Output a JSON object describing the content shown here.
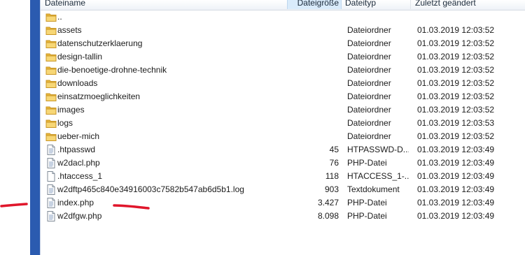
{
  "columns": {
    "name": "Dateiname",
    "size": "Dateigröße",
    "type": "Dateityp",
    "modified": "Zuletzt geändert"
  },
  "files": [
    {
      "name": "..",
      "size": "",
      "type": "",
      "modified": "",
      "icon": "folder-icon"
    },
    {
      "name": "assets",
      "size": "",
      "type": "Dateiordner",
      "modified": "01.03.2019 12:03:52",
      "icon": "folder-icon"
    },
    {
      "name": "datenschutzerklaerung",
      "size": "",
      "type": "Dateiordner",
      "modified": "01.03.2019 12:03:52",
      "icon": "folder-icon"
    },
    {
      "name": "design-tallin",
      "size": "",
      "type": "Dateiordner",
      "modified": "01.03.2019 12:03:52",
      "icon": "folder-icon"
    },
    {
      "name": "die-benoetige-drohne-technik",
      "size": "",
      "type": "Dateiordner",
      "modified": "01.03.2019 12:03:52",
      "icon": "folder-icon"
    },
    {
      "name": "downloads",
      "size": "",
      "type": "Dateiordner",
      "modified": "01.03.2019 12:03:52",
      "icon": "folder-icon"
    },
    {
      "name": "einsatzmoeglichkeiten",
      "size": "",
      "type": "Dateiordner",
      "modified": "01.03.2019 12:03:52",
      "icon": "folder-icon"
    },
    {
      "name": "images",
      "size": "",
      "type": "Dateiordner",
      "modified": "01.03.2019 12:03:52",
      "icon": "folder-icon"
    },
    {
      "name": "logs",
      "size": "",
      "type": "Dateiordner",
      "modified": "01.03.2019 12:03:53",
      "icon": "folder-icon"
    },
    {
      "name": "ueber-mich",
      "size": "",
      "type": "Dateiordner",
      "modified": "01.03.2019 12:03:52",
      "icon": "folder-icon"
    },
    {
      "name": ".htpasswd",
      "size": "45",
      "type": "HTPASSWD-D...",
      "modified": "01.03.2019 12:03:49",
      "icon": "text-file-icon"
    },
    {
      "name": "w2dacl.php",
      "size": "76",
      "type": "PHP-Datei",
      "modified": "01.03.2019 12:03:49",
      "icon": "text-file-icon"
    },
    {
      "name": ".htaccess_1",
      "size": "118",
      "type": "HTACCESS_1-...",
      "modified": "01.03.2019 12:03:49",
      "icon": "blank-file-icon"
    },
    {
      "name": "w2dftp465c840e34916003c7582b547ab6d5b1.log",
      "size": "903",
      "type": "Textdokument",
      "modified": "01.03.2019 12:03:49",
      "icon": "text-file-icon"
    },
    {
      "name": "index.php",
      "size": "3.427",
      "type": "PHP-Datei",
      "modified": "01.03.2019 12:03:49",
      "icon": "text-file-icon"
    },
    {
      "name": "w2dfgw.php",
      "size": "8.098",
      "type": "PHP-Datei",
      "modified": "01.03.2019 12:03:49",
      "icon": "text-file-icon"
    }
  ],
  "colors": {
    "sidebar": "#2b5bb0",
    "sorted_header": "#d9ebfb",
    "folder": "#e8b73a",
    "annotation": "#e0162b"
  }
}
